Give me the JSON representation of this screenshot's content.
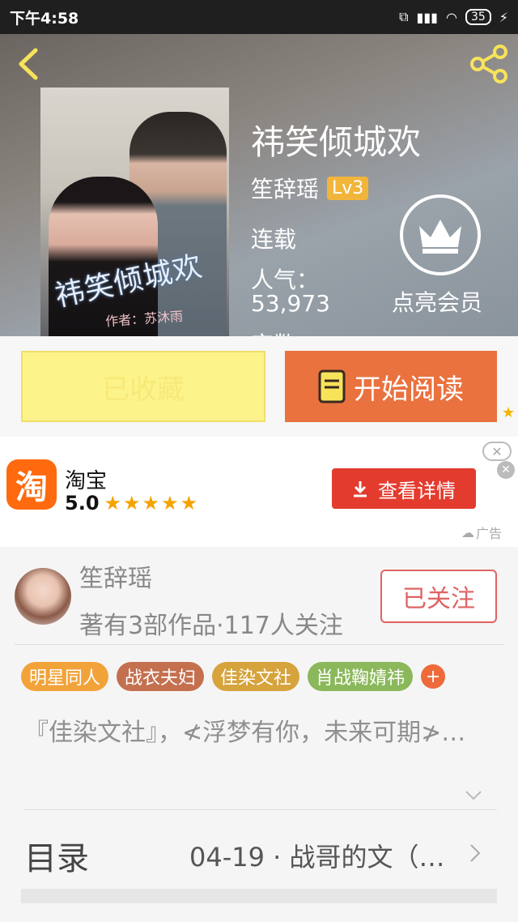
{
  "status_bar": {
    "time": "下午4:58",
    "battery": "35"
  },
  "book": {
    "title": "祎笑倾城欢",
    "author": "笙辞瑶",
    "level": "Lv3",
    "status": "连载",
    "popularity_label": "人气：",
    "popularity_value": "53,973",
    "wordcount_label": "字数",
    "cover_title": "祎笑倾城欢",
    "cover_author": "作者：苏沐雨"
  },
  "vip": {
    "label": "点亮会员"
  },
  "actions": {
    "collected_label": "已收藏",
    "read_label": "开始阅读"
  },
  "ad": {
    "logo_char": "淘",
    "app_name": "淘宝",
    "rating": "5.0",
    "stars": "★★★★★",
    "detail_label": "查看详情",
    "tag": "广告"
  },
  "author_profile": {
    "name": "笙辞瑶",
    "stats": "著有3部作品·117人关注",
    "follow_label": "已关注"
  },
  "tags": [
    {
      "label": "明星同人",
      "color": "#f1a33a"
    },
    {
      "label": "战衣夫妇",
      "color": "#c4704f"
    },
    {
      "label": "佳染文社",
      "color": "#d6a33c"
    },
    {
      "label": "肖战鞠婧祎",
      "color": "#8bb85a"
    }
  ],
  "tags_more": "+",
  "intro": "『佳染文社』，≮浮梦有你，未来可期≯…",
  "toc": {
    "label": "目录",
    "latest": "04-19 · 战哥的文（…"
  },
  "colors": {
    "accent": "#e9723f",
    "collected": "#fcf38a",
    "follow": "#e06363"
  }
}
